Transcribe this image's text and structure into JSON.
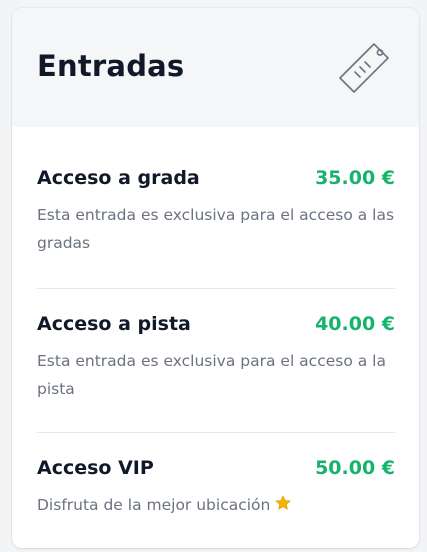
{
  "header": {
    "title": "Entradas",
    "icon": "ticket-tag-icon"
  },
  "tickets": [
    {
      "name": "Acceso a grada",
      "price": "35.00 €",
      "description": "Esta entrada es exclusiva para el acceso a las gradas"
    },
    {
      "name": "Acceso a pista",
      "price": "40.00 €",
      "description": "Esta entrada es exclusiva para el acceso a la pista"
    },
    {
      "name": "Acceso VIP",
      "price": "50.00 €",
      "description": "Disfruta de la mejor ubicación",
      "badge_icon": "star-icon"
    }
  ],
  "colors": {
    "price": "#16b36c",
    "title": "#111827",
    "description": "#6b7280",
    "star": "#f5b400"
  }
}
